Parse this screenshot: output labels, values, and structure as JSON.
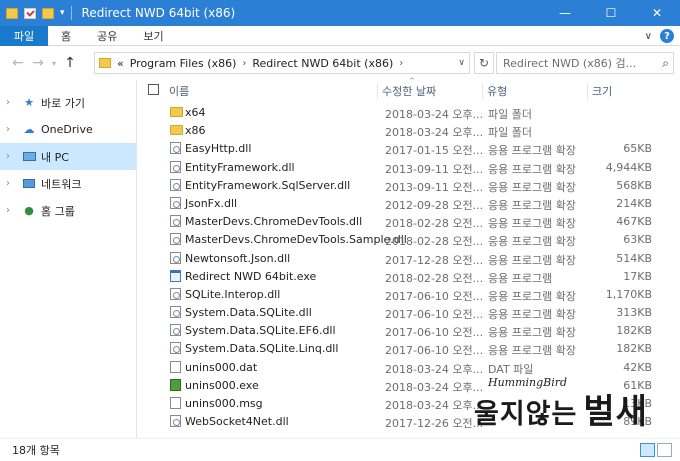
{
  "window": {
    "title": "Redirect NWD 64bit (x86)",
    "minimize": "—",
    "maximize": "☐",
    "close": "✕"
  },
  "ribbon": {
    "tabs": [
      "파일",
      "홈",
      "공유",
      "보기"
    ],
    "expand": "∨",
    "help": "?"
  },
  "address": {
    "prefix": "«",
    "crumbs": [
      "Program Files (x86)",
      "Redirect NWD 64bit (x86)"
    ],
    "chevron": "›",
    "search_placeholder": "Redirect NWD (x86) 검..."
  },
  "sidebar": {
    "items": [
      {
        "label": "바로 가기",
        "icon": "star-icon"
      },
      {
        "label": "OneDrive",
        "icon": "cloud-icon"
      },
      {
        "label": "내 PC",
        "icon": "computer-icon",
        "selected": true
      },
      {
        "label": "네트워크",
        "icon": "network-icon"
      },
      {
        "label": "홈 그룹",
        "icon": "homegroup-icon"
      }
    ]
  },
  "columns": {
    "name": "이름",
    "modified": "수정한 날짜",
    "type": "유형",
    "size": "크기"
  },
  "files": [
    {
      "name": "x64",
      "date": "2018-03-24 오후...",
      "type": "파일 폴더",
      "size": "",
      "kind": "folder"
    },
    {
      "name": "x86",
      "date": "2018-03-24 오후...",
      "type": "파일 폴더",
      "size": "",
      "kind": "folder"
    },
    {
      "name": "EasyHttp.dll",
      "date": "2017-01-15 오전...",
      "type": "응용 프로그램 확장",
      "size": "65KB",
      "kind": "dll"
    },
    {
      "name": "EntityFramework.dll",
      "date": "2013-09-11 오전...",
      "type": "응용 프로그램 확장",
      "size": "4,944KB",
      "kind": "dll"
    },
    {
      "name": "EntityFramework.SqlServer.dll",
      "date": "2013-09-11 오전...",
      "type": "응용 프로그램 확장",
      "size": "568KB",
      "kind": "dll"
    },
    {
      "name": "JsonFx.dll",
      "date": "2012-09-28 오전...",
      "type": "응용 프로그램 확장",
      "size": "214KB",
      "kind": "dll"
    },
    {
      "name": "MasterDevs.ChromeDevTools.dll",
      "date": "2018-02-28 오전...",
      "type": "응용 프로그램 확장",
      "size": "467KB",
      "kind": "dll"
    },
    {
      "name": "MasterDevs.ChromeDevTools.Sample.dll",
      "date": "2018-02-28 오전...",
      "type": "응용 프로그램 확장",
      "size": "63KB",
      "kind": "dll"
    },
    {
      "name": "Newtonsoft.Json.dll",
      "date": "2017-12-28 오전...",
      "type": "응용 프로그램 확장",
      "size": "514KB",
      "kind": "dll"
    },
    {
      "name": "Redirect NWD 64bit.exe",
      "date": "2018-02-28 오전...",
      "type": "응용 프로그램",
      "size": "17KB",
      "kind": "exe"
    },
    {
      "name": "SQLite.Interop.dll",
      "date": "2017-06-10 오전...",
      "type": "응용 프로그램 확장",
      "size": "1,170KB",
      "kind": "dll"
    },
    {
      "name": "System.Data.SQLite.dll",
      "date": "2017-06-10 오전...",
      "type": "응용 프로그램 확장",
      "size": "313KB",
      "kind": "dll"
    },
    {
      "name": "System.Data.SQLite.EF6.dll",
      "date": "2017-06-10 오전...",
      "type": "응용 프로그램 확장",
      "size": "182KB",
      "kind": "dll"
    },
    {
      "name": "System.Data.SQLite.Linq.dll",
      "date": "2017-06-10 오전...",
      "type": "응용 프로그램 확장",
      "size": "182KB",
      "kind": "dll"
    },
    {
      "name": "unins000.dat",
      "date": "2018-03-24 오후...",
      "type": "DAT 파일",
      "size": "42KB",
      "kind": "file"
    },
    {
      "name": "unins000.exe",
      "date": "2018-03-24 오후...",
      "type": "",
      "size": "61KB",
      "kind": "setup"
    },
    {
      "name": "unins000.msg",
      "date": "2018-03-24 오후...",
      "type": "",
      "size": "13KB",
      "kind": "file"
    },
    {
      "name": "WebSocket4Net.dll",
      "date": "2017-12-26 오전...",
      "type": "",
      "size": "89KB",
      "kind": "dll"
    }
  ],
  "status": {
    "count": "18개 항목"
  },
  "watermark": {
    "small": "HummingBird",
    "big": "울지않는",
    "big2": "벌새"
  }
}
